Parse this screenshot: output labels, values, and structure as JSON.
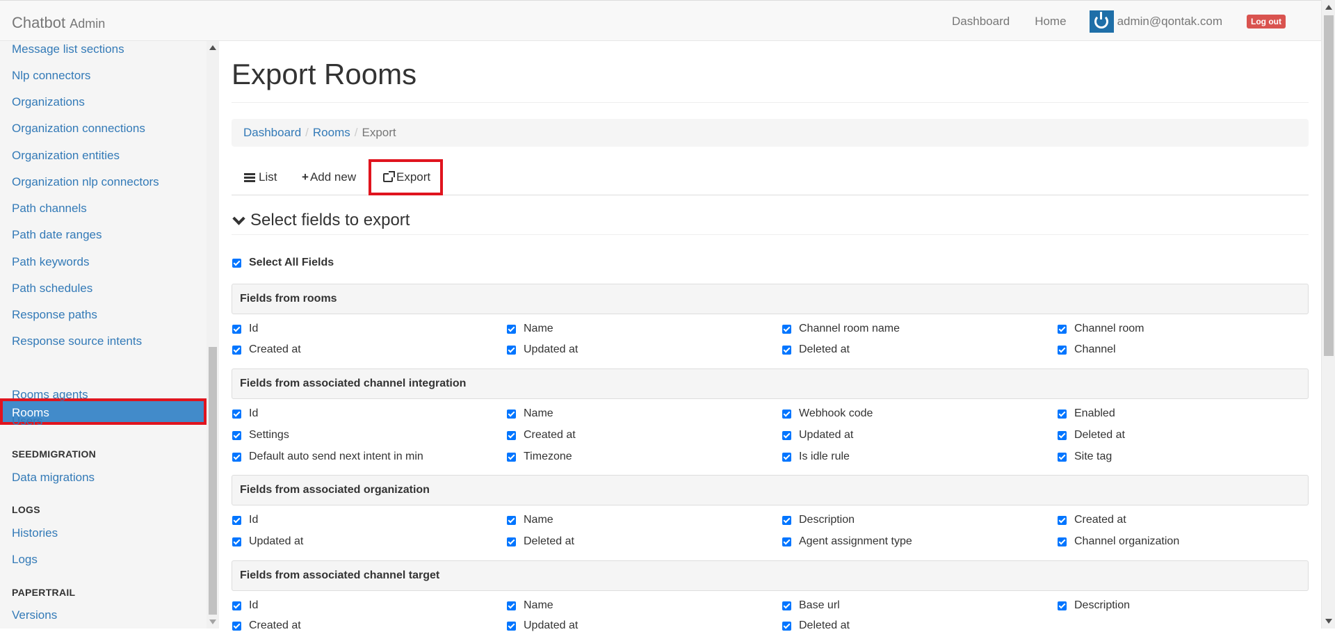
{
  "navbar": {
    "brand": "Chatbot",
    "brand_sub": "Admin",
    "links": [
      "Dashboard",
      "Home"
    ],
    "user_email": "admin@qontak.com",
    "logout_label": "Log out"
  },
  "sidebar": {
    "items_top": [
      "Message list sections",
      "Nlp connectors",
      "Organizations",
      "Organization connections",
      "Organization entities",
      "Organization nlp connectors",
      "Path channels",
      "Path date ranges",
      "Path keywords",
      "Path schedules",
      "Response paths",
      "Response source intents"
    ],
    "active_item": "Rooms",
    "items_after_active": [
      "Rooms agents",
      "Users"
    ],
    "section_seedmigration": "SEEDMIGRATION",
    "item_data_migrations": "Data migrations",
    "section_logs": "LOGS",
    "item_histories": "Histories",
    "item_logs": "Logs",
    "section_papertrail": "PAPERTRAIL",
    "item_versions": "Versions"
  },
  "main": {
    "title": "Export Rooms",
    "breadcrumb": [
      "Dashboard",
      "Rooms",
      "Export"
    ],
    "tabs": {
      "list": "List",
      "add_new": "Add new",
      "export": "Export"
    },
    "section_title": "Select fields to export",
    "select_all_label": "Select All Fields",
    "groups": [
      {
        "title": "Fields from rooms",
        "fields": [
          "Id",
          "Name",
          "Channel room name",
          "Channel room",
          "Created at",
          "Updated at",
          "Deleted at",
          "Channel"
        ]
      },
      {
        "title": "Fields from associated channel integration",
        "fields": [
          "Id",
          "Name",
          "Webhook code",
          "Enabled",
          "Settings",
          "Created at",
          "Updated at",
          "Deleted at",
          "Default auto send next intent in min",
          "Timezone",
          "Is idle rule",
          "Site tag"
        ]
      },
      {
        "title": "Fields from associated organization",
        "fields": [
          "Id",
          "Name",
          "Description",
          "Created at",
          "Updated at",
          "Deleted at",
          "Agent assignment type",
          "Channel organization"
        ]
      },
      {
        "title": "Fields from associated channel target",
        "fields": [
          "Id",
          "Name",
          "Base url",
          "Description",
          "Created at",
          "Updated at",
          "Deleted at"
        ]
      }
    ]
  },
  "colors": {
    "link": "#337ab7",
    "active": "#428bca",
    "highlight": "#e0141e",
    "logout": "#d9534f",
    "checkbox": "#0075ff"
  }
}
